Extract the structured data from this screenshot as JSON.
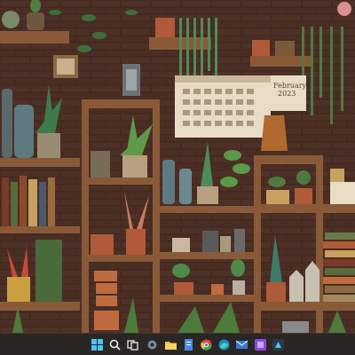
{
  "wallpaper": {
    "description_items": [
      "potted-plants",
      "wooden-shelves",
      "wall-calendar",
      "bottles"
    ],
    "calendar": {
      "month": "February",
      "year": "2023"
    }
  },
  "taskbar": {
    "icons": [
      {
        "name": "start-icon"
      },
      {
        "name": "search-icon"
      },
      {
        "name": "task-view-icon"
      },
      {
        "name": "settings-icon"
      },
      {
        "name": "file-explorer-icon"
      },
      {
        "name": "notes-icon"
      },
      {
        "name": "chrome-icon"
      },
      {
        "name": "edge-icon"
      },
      {
        "name": "mail-icon"
      },
      {
        "name": "app-purple-icon"
      },
      {
        "name": "app-teal-icon"
      }
    ]
  },
  "colors": {
    "taskbar_bg": "#2a2624",
    "brick": "#4a2e24",
    "wood": "#8a5a38"
  }
}
